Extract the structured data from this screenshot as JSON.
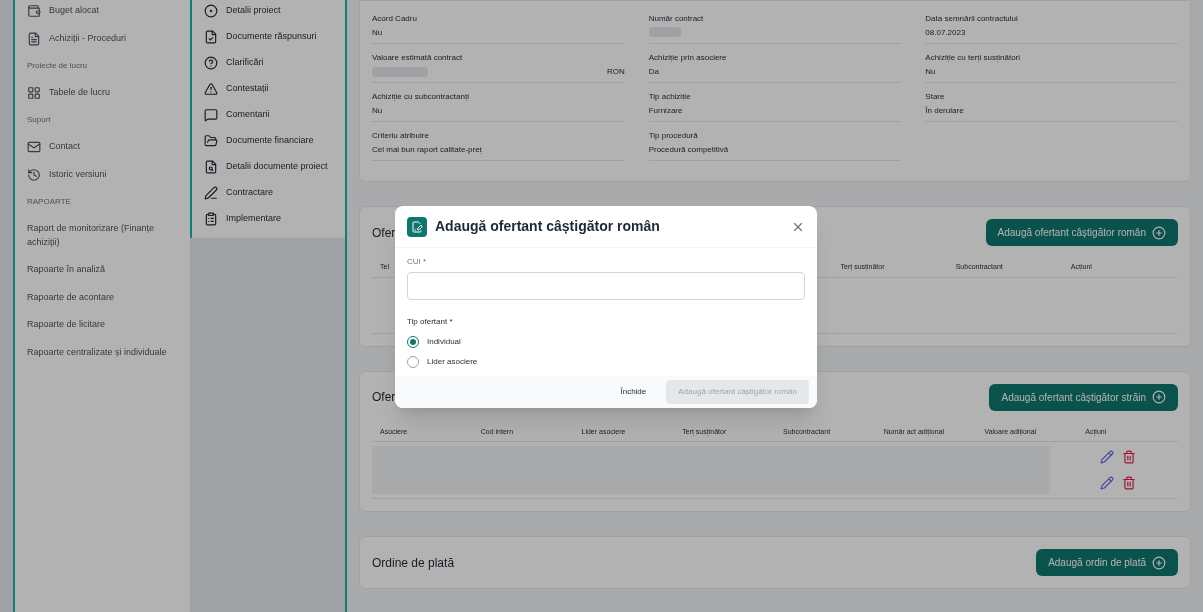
{
  "sidebar": {
    "items": [
      {
        "kind": "link",
        "label": "Buget alocat"
      },
      {
        "kind": "link",
        "label": "Achiziții - Proceduri"
      },
      {
        "kind": "section",
        "label": "Proiecte de lucru"
      },
      {
        "kind": "link",
        "label": "Tabele de lucru"
      },
      {
        "kind": "section",
        "label": "Suport"
      },
      {
        "kind": "link",
        "label": "Contact"
      },
      {
        "kind": "link",
        "label": "Istoric versiuni"
      },
      {
        "kind": "section",
        "label": "RAPOARTE"
      },
      {
        "kind": "plain",
        "label": "Raport de monitorizare (Finanțe achiziții)"
      },
      {
        "kind": "plain",
        "label": "Rapoarte în analiză"
      },
      {
        "kind": "plain",
        "label": "Rapoarte de acontare"
      },
      {
        "kind": "plain",
        "label": "Rapoarte de licitare"
      },
      {
        "kind": "plain",
        "label": "Rapoarte centralizate și individuale"
      }
    ]
  },
  "subnav": {
    "items": [
      "Detalii proiect",
      "Documente răspunsuri",
      "Clarificări",
      "Contestații",
      "Comentarii",
      "Documente financiare",
      "Detalii documente proiect",
      "Contractare",
      "Implementare"
    ]
  },
  "details": [
    {
      "label": "Acord Cadru",
      "value": "Nu"
    },
    {
      "label": "Număr contract",
      "hidden": true
    },
    {
      "label": "Data semnării contractului",
      "value": "08.07.2023"
    },
    {
      "label": "Valoare estimată contract",
      "hidden": true,
      "unit": "RON"
    },
    {
      "label": "Achiziție prin asociere",
      "value": "Da"
    },
    {
      "label": "Achiziție cu terți susținători",
      "value": "Nu"
    },
    {
      "label": "Achiziție cu subcontractanți",
      "value": "Nu"
    },
    {
      "label": "Tip achiziție",
      "value": "Furnizare"
    },
    {
      "label": "Stare",
      "value": "În derulare"
    },
    {
      "label": "Criteriu atribuire",
      "value": "Cel mai bun raport calitate-preț"
    },
    {
      "label": "Tip procedură",
      "value": "Procedură competitivă"
    }
  ],
  "sections": [
    {
      "title": "Ofer",
      "button": "Adaugă ofertant câștigător român",
      "columns": [
        "Tel",
        "",
        "",
        "",
        "Terț susținător",
        "Subcontractant",
        "Acțiuni"
      ]
    },
    {
      "title": "Ofer",
      "button": "Adaugă ofertant câștigător străin",
      "columns": [
        "Asociere",
        "Cod intern",
        "Lider asociere",
        "Terț susținător",
        "Subcontractant",
        "Număr act adițional",
        "Valoare adițional",
        "Acțiuni"
      ],
      "rows": [
        {
          "placeholder": true
        },
        {
          "placeholder": true
        }
      ]
    },
    {
      "title": "Ordine de plată",
      "button": "Adaugă ordin de plată"
    }
  ],
  "modal": {
    "title": "Adaugă ofertant câștigător român",
    "field": {
      "label": "CUI *"
    },
    "radio_label": "Tip ofertant *",
    "options": [
      {
        "label": "Individual",
        "selected": true
      },
      {
        "label": "Lider asociere",
        "selected": false
      }
    ],
    "cancel": "Închide",
    "submit": {
      "label": "Adaugă ofertant câștigător român",
      "disabled": true
    }
  }
}
